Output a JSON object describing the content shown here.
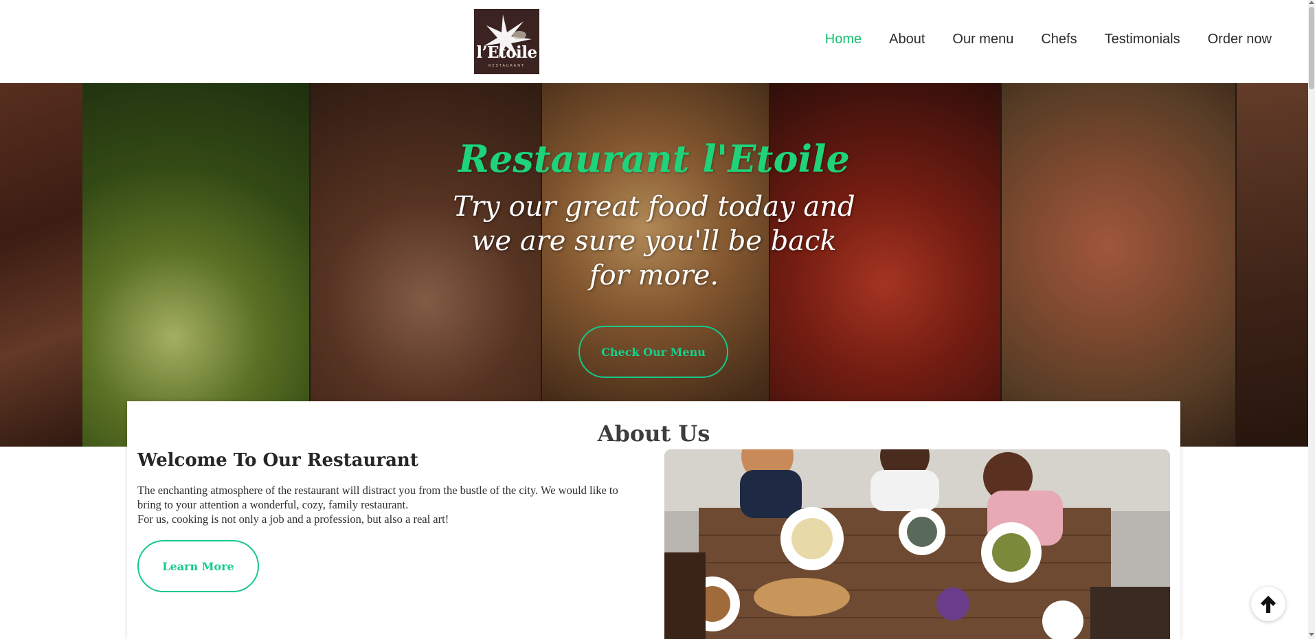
{
  "brand": {
    "logo_text": "l’Etoile",
    "logo_sub": "RESTAURANT"
  },
  "nav": {
    "items": [
      {
        "label": "Home",
        "active": true
      },
      {
        "label": "About",
        "active": false
      },
      {
        "label": "Our menu",
        "active": false
      },
      {
        "label": "Chefs",
        "active": false
      },
      {
        "label": "Testimonials",
        "active": false
      },
      {
        "label": "Order now",
        "active": false
      }
    ]
  },
  "hero": {
    "title": "Restaurant l'Etoile",
    "subtitle": "Try our great food today and we are sure you'll be back for more.",
    "button_label": "Check Our Menu"
  },
  "about": {
    "section_title": "About Us",
    "heading": "Welcome To Our Restaurant",
    "paragraph_1": "The enchanting atmosphere of the restaurant will distract you from the bustle of the city. We would like to bring to your attention a wonderful, cozy, family restaurant.",
    "paragraph_2": "For us, cooking is not only a job and a profession, but also a real art!",
    "button_label": "Learn More"
  },
  "icons": {
    "scroll_top": "arrow-up-icon",
    "logo_star": "star-icon"
  },
  "colors": {
    "accent": "#14c16b",
    "button_border": "#14c98a",
    "logo_bg": "#3a2320"
  }
}
